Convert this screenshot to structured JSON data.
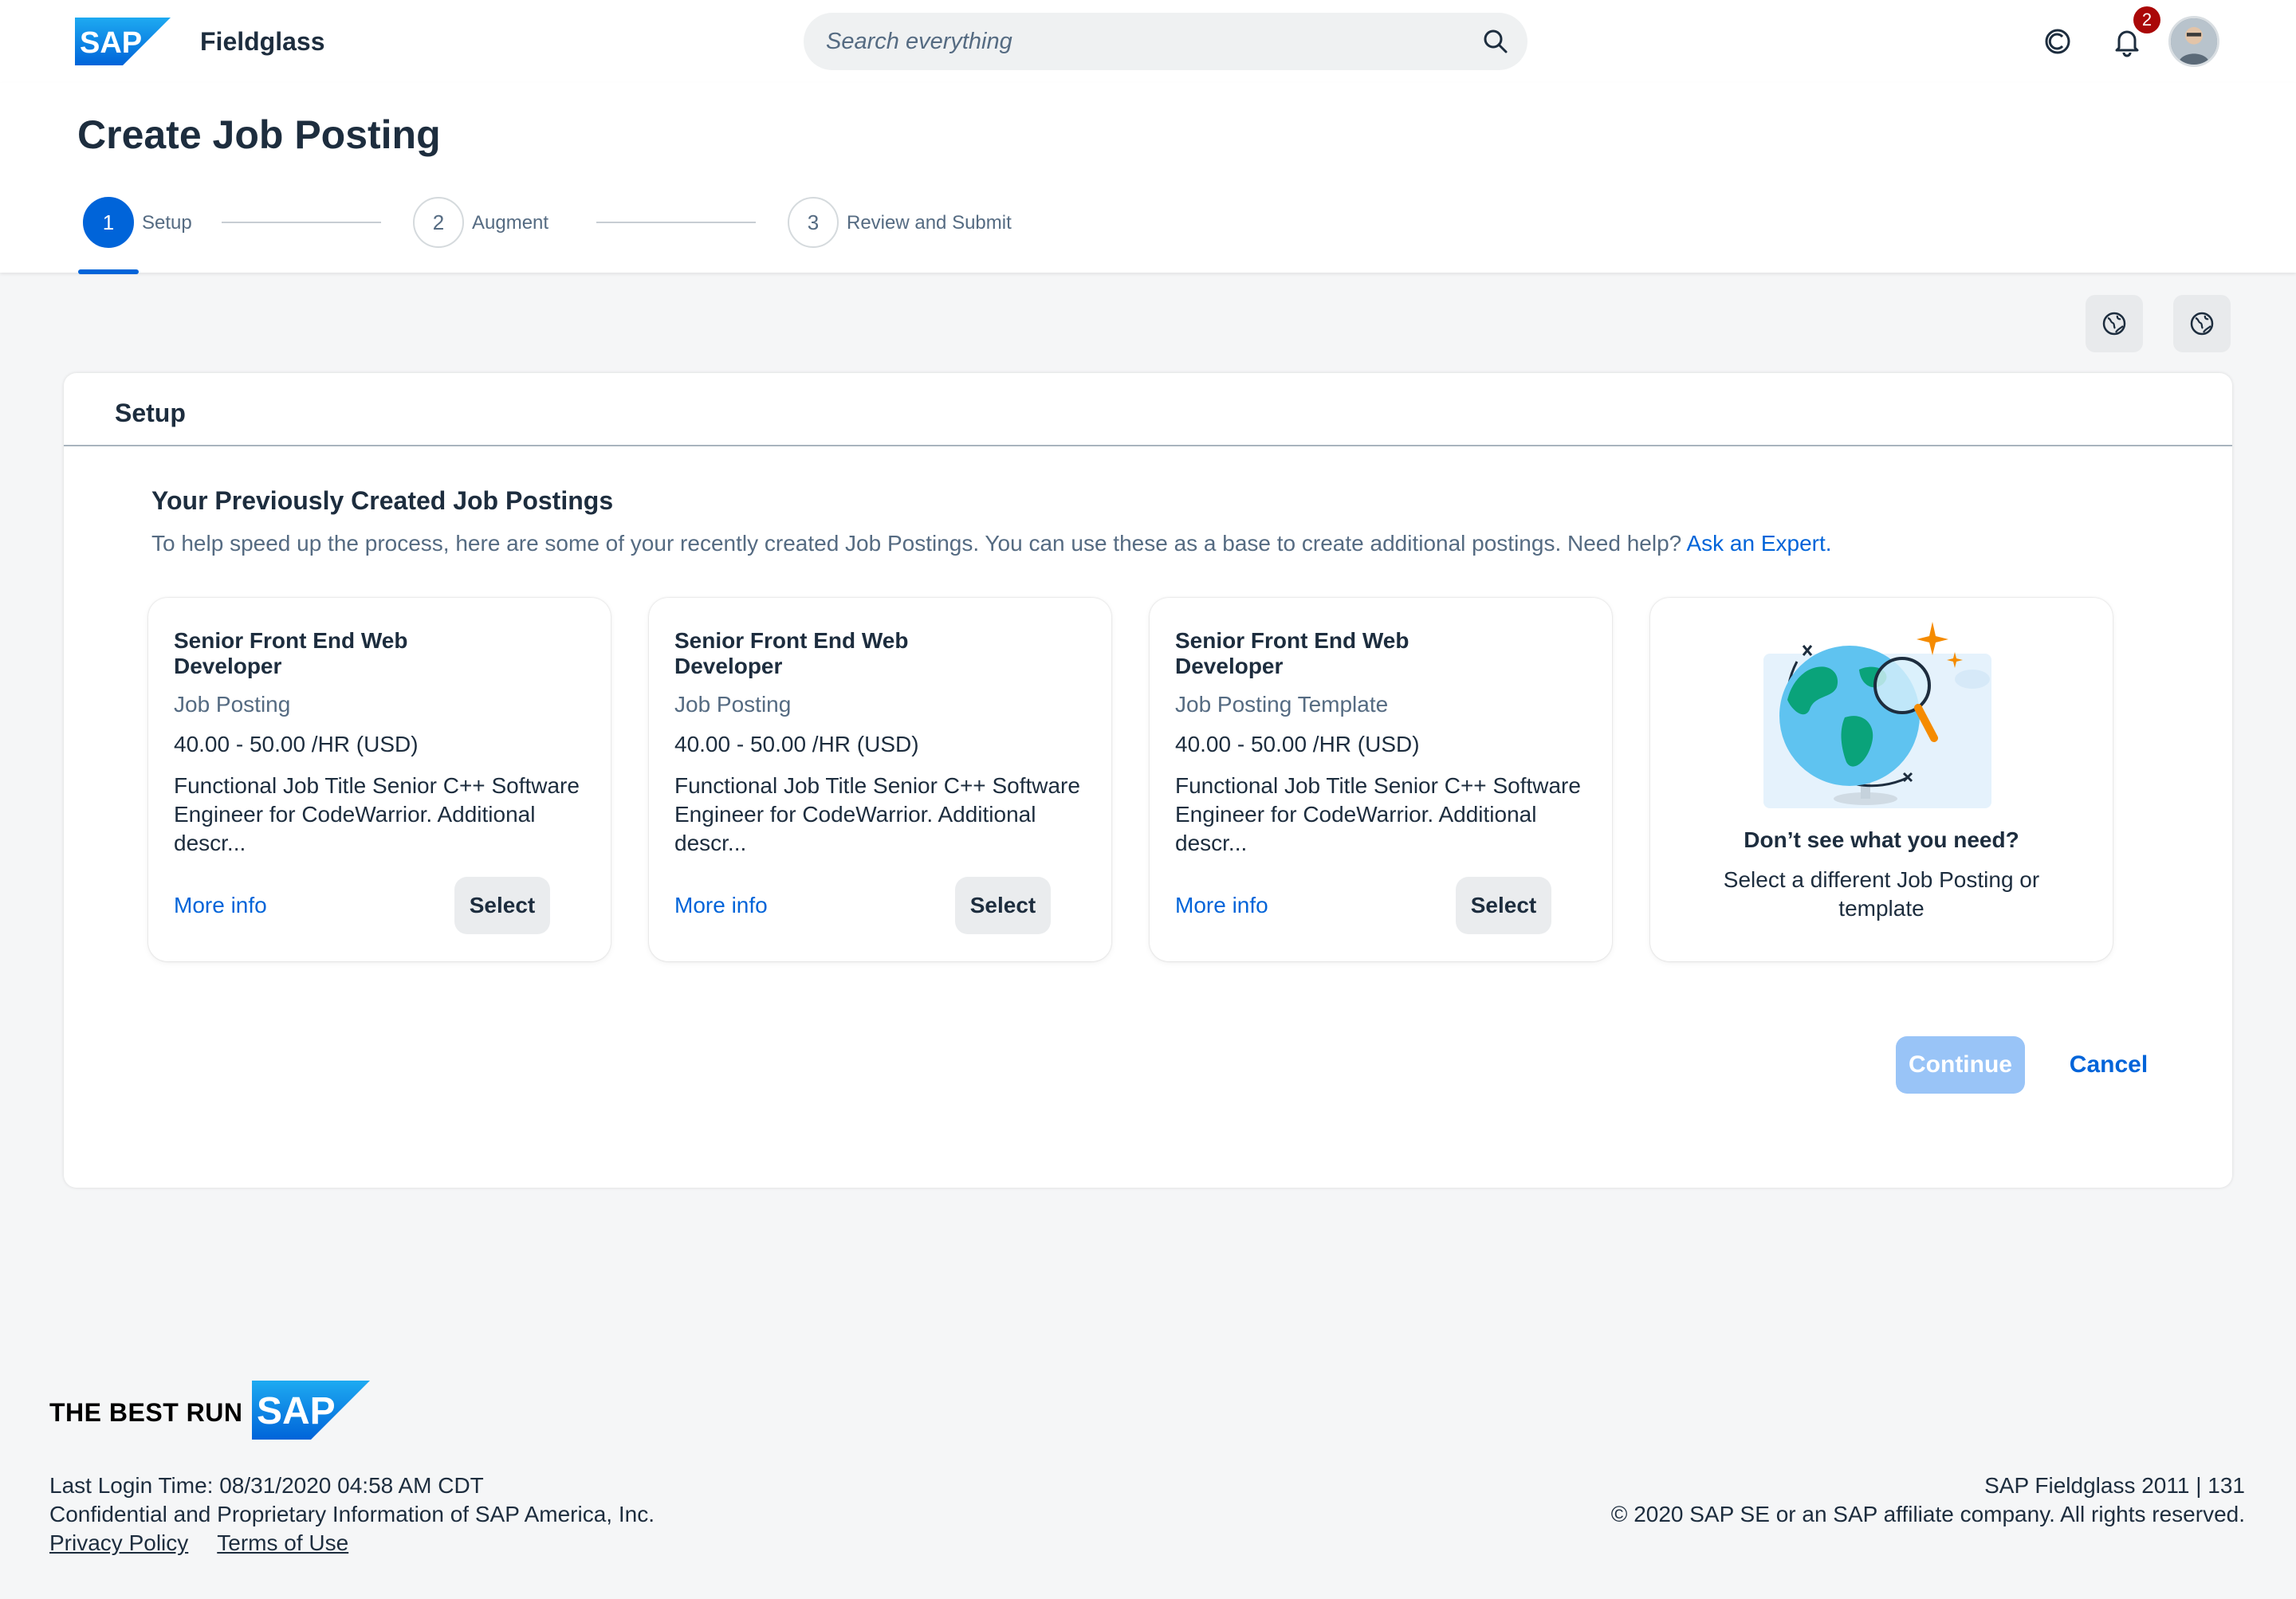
{
  "header": {
    "logo_text": "SAP",
    "app_name": "Fieldglass",
    "search_placeholder": "Search everything",
    "notification_count": "2",
    "icons": [
      "copilot-icon",
      "bell-icon",
      "search-icon"
    ]
  },
  "page": {
    "title": "Create Job Posting",
    "steps": [
      {
        "number": "1",
        "label": "Setup",
        "active": true
      },
      {
        "number": "2",
        "label": "Augment",
        "active": false
      },
      {
        "number": "3",
        "label": "Review and Submit",
        "active": false
      }
    ]
  },
  "toolbar": {
    "icons": [
      "globe-icon",
      "globe-icon"
    ]
  },
  "panel": {
    "title": "Setup",
    "section_title": "Your Previously Created Job Postings",
    "section_desc": "To help speed up the process, here are some of your recently created Job Postings. You can use these as a base to create additional postings. Need help?",
    "help_link": "Ask an Expert."
  },
  "cards": [
    {
      "title": "Senior Front End Web Developer",
      "type": "Job Posting",
      "rate": "40.00 - 50.00 /HR (USD)",
      "description": "Functional Job Title Senior C++ Software Engineer for CodeWarrior. Additional descr...",
      "link": "More info",
      "button": "Select"
    },
    {
      "title": "Senior Front End Web Developer",
      "type": "Job Posting",
      "rate": "40.00 - 50.00 /HR (USD)",
      "description": "Functional Job Title Senior C++ Software Engineer for CodeWarrior. Additional descr...",
      "link": "More info",
      "button": "Select"
    },
    {
      "title": "Senior Front End Web Developer",
      "type": "Job Posting Template",
      "rate": "40.00 - 50.00 /HR (USD)",
      "description": "Functional Job Title Senior C++ Software Engineer for CodeWarrior. Additional descr...",
      "link": "More info",
      "button": "Select"
    }
  ],
  "illustration_card": {
    "title": "Don’t see what you need?",
    "description": "Select a different Job Posting or template"
  },
  "actions": {
    "continue": "Continue",
    "cancel": "Cancel"
  },
  "footer": {
    "tagline": "THE BEST RUN",
    "logo_text": "SAP",
    "last_login": "Last Login Time: 08/31/2020 04:58 AM CDT",
    "confidential": "Confidential and Proprietary Information of SAP America, Inc.",
    "privacy": "Privacy Policy",
    "terms": "Terms of Use",
    "version": "SAP Fieldglass 2011 | 131",
    "copyright": "© 2020 SAP SE or an SAP affiliate company. All rights reserved."
  },
  "colors": {
    "brand_blue": "#0064d9",
    "sap_logo_blue": "#1a73c8",
    "badge_red": "#aa0808",
    "continue_disabled": "#99c4f7"
  }
}
